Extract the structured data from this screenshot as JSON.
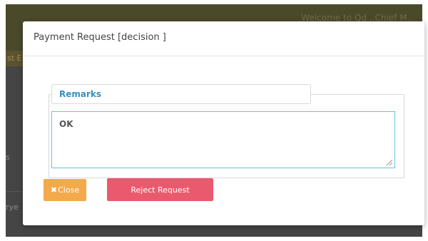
{
  "background": {
    "welcome_text": "Welcome to Qd...Chief M...",
    "strip_text": "st E",
    "side_text_1": "s",
    "side_text_2": "rye"
  },
  "modal": {
    "title": "Payment Request [decision ]",
    "remarks_legend": "Remarks",
    "remarks_value": "OK",
    "close_icon": "x-icon",
    "close_label": "Close",
    "reject_label": "Reject Request"
  },
  "colors": {
    "close_button": "#f4a94a",
    "reject_button": "#ea5a6e",
    "legend_text": "#3a8fc4",
    "textarea_border": "#66c2e0"
  }
}
